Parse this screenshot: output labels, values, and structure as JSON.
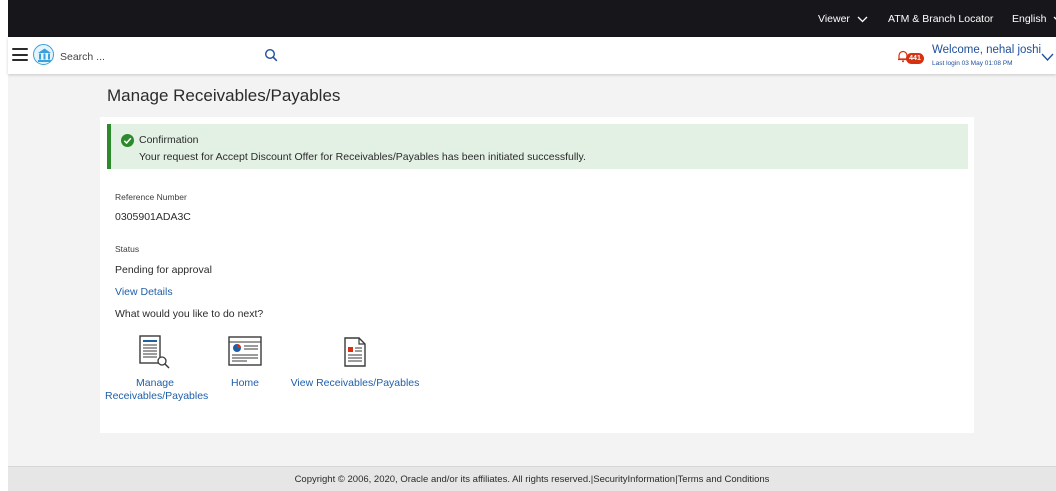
{
  "topbar": {
    "viewer_label": "Viewer",
    "locator_label": "ATM & Branch Locator",
    "language_label": "English"
  },
  "header": {
    "search_placeholder": "Search ...",
    "notification_count": "441",
    "welcome_text": "Welcome, nehal joshi",
    "last_login": "Last login 03 May 01:08 PM"
  },
  "page": {
    "title": "Manage Receivables/Payables"
  },
  "confirmation": {
    "title": "Confirmation",
    "message": "Your request for Accept Discount Offer for Receivables/Payables has been initiated successfully."
  },
  "details": {
    "reference_label": "Reference Number",
    "reference_value": "0305901ADA3C",
    "status_label": "Status",
    "status_value": "Pending for approval",
    "view_details": "View Details",
    "next_prompt": "What would you like to do next?"
  },
  "actions": [
    {
      "line1": "Manage",
      "line2": "Receivables/Payables"
    },
    {
      "line1": "Home",
      "line2": ""
    },
    {
      "line1": "View Receivables/Payables",
      "line2": ""
    }
  ],
  "footer": {
    "text": "Copyright © 2006, 2020, Oracle and/or its affiliates. All rights reserved.|SecurityInformation|Terms and Conditions"
  },
  "colors": {
    "topbar_bg": "#17161b",
    "link": "#1f5fa8",
    "success_bg": "#e3f0e4",
    "success_accent": "#2c8a2c",
    "badge": "#d6320f"
  },
  "icons": [
    "hamburger-icon",
    "bank-logo-icon",
    "search-icon",
    "bell-icon",
    "chevron-down-icon",
    "check-circle-icon",
    "document-search-icon",
    "dashboard-icon",
    "document-icon"
  ]
}
